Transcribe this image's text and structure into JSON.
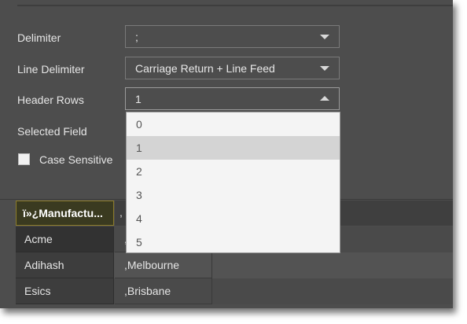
{
  "form": {
    "delimiter": {
      "label": "Delimiter",
      "value": ";"
    },
    "line_delimiter": {
      "label": "Line Delimiter",
      "value": "Carriage Return + Line Feed"
    },
    "header_rows": {
      "label": "Header Rows",
      "value": "1",
      "options": [
        "0",
        "1",
        "2",
        "3",
        "4",
        "5"
      ],
      "selected_index": 1
    },
    "selected_field": {
      "label": "Selected Field"
    },
    "case_sensitive": {
      "label": "Case Sensitive",
      "checked": false
    }
  },
  "grid": {
    "header": [
      "ï»¿Manufactu...",
      ","
    ],
    "rows": [
      [
        "Acme",
        ","
      ],
      [
        "Adihash",
        ",Melbourne"
      ],
      [
        "Esics",
        ",Brisbane"
      ]
    ]
  },
  "colors": {
    "panel_bg": "#4d4d4d",
    "dropdown_bg": "#f4f4f4",
    "dropdown_selected": "#d4d4d4",
    "header_border": "#8c7c2a"
  }
}
